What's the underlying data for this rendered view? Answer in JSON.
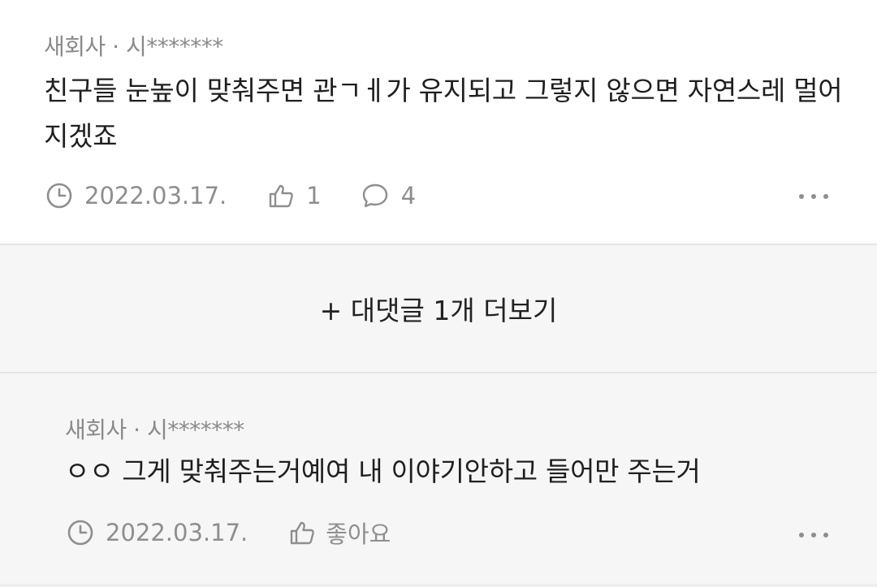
{
  "comments": [
    {
      "author": "새회사 · 시*******",
      "text": "친구들 눈높이 맞춰주면 관ㄱㅔ가 유지되고 그렇지 않으면 자연스레 멀어지겠죠",
      "date": "2022.03.17.",
      "likes": "1",
      "replies": "4"
    }
  ],
  "more_replies_label": "+ 대댓글 1개 더보기",
  "reply": {
    "author": "새회사 · 시*******",
    "text": "ㅇㅇ 그게 맞춰주는거예여 내 이야기안하고 들어만 주는거",
    "date": "2022.03.17.",
    "like_label": "좋아요"
  },
  "icons": {
    "clock": "clock-icon",
    "thumbs_up": "thumbs-up-icon",
    "speech_bubble": "comment-icon",
    "more": "more-horizontal-icon"
  },
  "colors": {
    "meta_gray": "#8e8e8e",
    "reply_background": "#f6f6f6"
  }
}
